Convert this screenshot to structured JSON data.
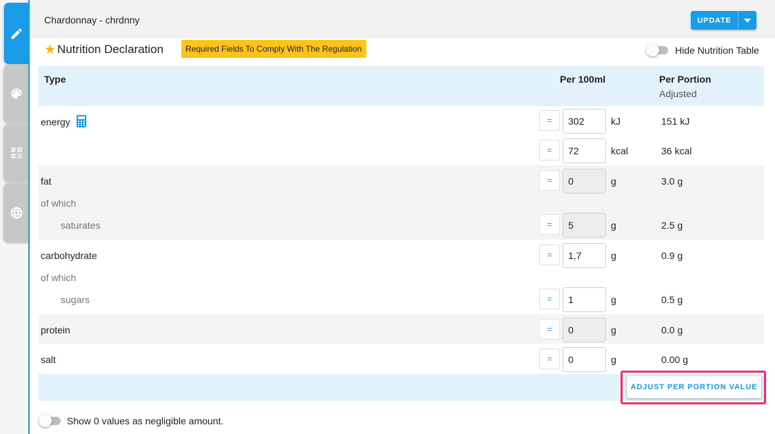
{
  "header": {
    "product_title": "Chardonnay - chrdnny",
    "update_label": "UPDATE"
  },
  "tabs": [
    {
      "icon": "pencil-icon",
      "active": true
    },
    {
      "icon": "palette-icon",
      "active": false
    },
    {
      "icon": "qr-code-icon",
      "active": false
    },
    {
      "icon": "globe-icon",
      "active": false
    }
  ],
  "section": {
    "title": "Nutrition Declaration",
    "required_badge": "Required Fields To Comply With The Regulation",
    "hide_table_label": "Hide Nutrition Table",
    "hide_table_on": false
  },
  "table": {
    "col_type": "Type",
    "col_per100": "Per 100ml",
    "col_portion": "Per Portion",
    "col_portion_sub": "Adjusted",
    "equals_label": "=",
    "rows": {
      "energy_kj": {
        "label": "energy",
        "value": "302",
        "unit": "kJ",
        "portion": "151 kJ"
      },
      "energy_kcal": {
        "value": "72",
        "unit": "kcal",
        "portion": "36 kcal"
      },
      "fat": {
        "label": "fat",
        "value": "0",
        "unit": "g",
        "portion": "3.0 g"
      },
      "fat_of_which": "of which",
      "saturates": {
        "label": "saturates",
        "value": "5",
        "unit": "g",
        "portion": "2.5 g"
      },
      "carbohydrate": {
        "label": "carbohydrate",
        "value": "1,7",
        "unit": "g",
        "portion": "0.9 g"
      },
      "carb_of_which": "of which",
      "sugars": {
        "label": "sugars",
        "value": "1",
        "unit": "g",
        "portion": "0.5 g"
      },
      "protein": {
        "label": "protein",
        "value": "0",
        "unit": "g",
        "portion": "0.0 g"
      },
      "salt": {
        "label": "salt",
        "value": "0",
        "unit": "g",
        "portion": "0.00 g"
      }
    },
    "adjust_button": "ADJUST PER PORTION VALUE"
  },
  "footer": {
    "negligible_label": "Show 0 values as negligible amount.",
    "negligible_on": false
  },
  "colors": {
    "accent": "#1a9be6",
    "badge": "#ffc31a",
    "highlight": "#e8336a",
    "header_band": "#e2f2fb"
  }
}
